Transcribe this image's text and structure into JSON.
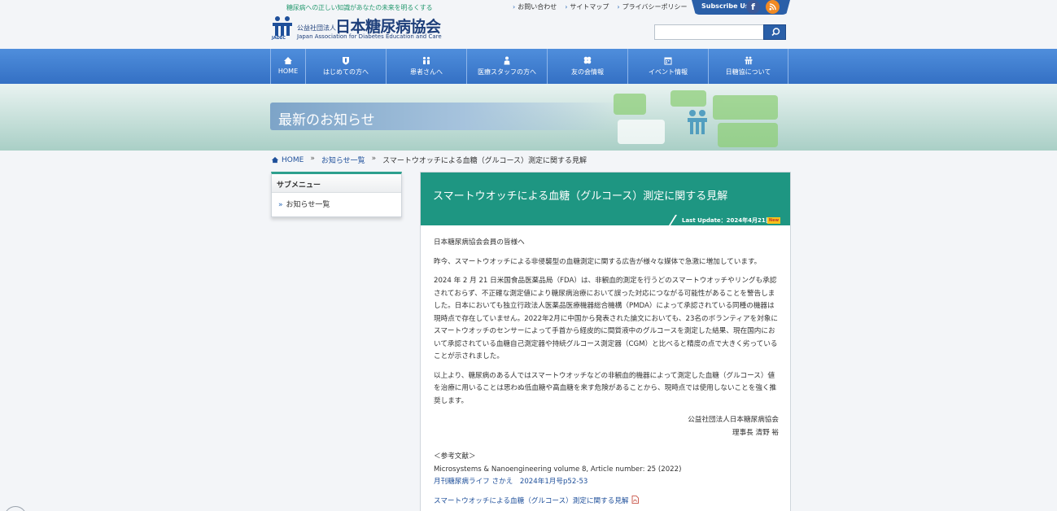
{
  "header": {
    "tagline": "糖尿病への正しい知識があなたの未来を明るくする",
    "logo_caption": "JADEC",
    "org_prefix": "公益社団法人",
    "org_name": "日本糖尿病協会",
    "org_name_en": "Japan Association for Diabetes Education and Care",
    "util_links": [
      "お問い合わせ",
      "サイトマップ",
      "プライバシーポリシー"
    ],
    "subscribe_label": "Subscribe Us",
    "facebook_glyph": "f",
    "search_placeholder": ""
  },
  "nav": {
    "items": [
      {
        "label": "HOME",
        "icon": "home-icon"
      },
      {
        "label": "はじめての方へ",
        "icon": "shield-icon"
      },
      {
        "label": "患者さんへ",
        "icon": "people-icon"
      },
      {
        "label": "医療スタッフの方へ",
        "icon": "doctor-icon"
      },
      {
        "label": "友の会情報",
        "icon": "clover-icon"
      },
      {
        "label": "イベント情報",
        "icon": "calendar-icon"
      },
      {
        "label": "日糖協について",
        "icon": "building-icon"
      }
    ]
  },
  "banner": {
    "title": "最新のお知らせ"
  },
  "breadcrumb": {
    "home": "HOME",
    "list": "お知らせ一覧",
    "current": "スマートウオッチによる血糖（グルコース）測定に関する見解",
    "separator": "»"
  },
  "submenu": {
    "title": "サブメニュー",
    "items": [
      "お知らせ一覧"
    ]
  },
  "article": {
    "title": "スマートウオッチによる血糖（グルコース）測定に関する見解",
    "last_update": "Last Update：2024年4月21日",
    "new_badge": "New",
    "greeting": "日本糖尿病協会会員の皆様へ",
    "p1": "昨今、スマートウオッチによる非侵襲型の血糖測定に関する広告が様々な媒体で急激に増加しています。",
    "p2": "2024 年 2 月 21 日米国食品医薬品局（FDA）は、非観血的測定を行うどのスマートウオッチやリングも承認されておらず、不正確な測定値により糖尿病治療において誤った対応につながる可能性があることを警告しました。日本においても独立行政法人医薬品医療機器総合機構（PMDA）によって承認されている同種の機器は現時点で存在していません。2022年2月に中国から発表された論文においても、23名のボランティアを対象にスマートウオッチのセンサーによって手首から経皮的に間質液中のグルコースを測定した結果、現在国内において承認されている血糖自己測定器や持続グルコース測定器（CGM）と比べると精度の点で大きく劣っていることが示されました。",
    "p3": "以上より、糖尿病のある人ではスマートウオッチなどの非観血的機器によって測定した血糖（グルコース）値を治療に用いることは思わぬ低血糖や高血糖を来す危険があることから、現時点では使用しないことを強く推奨します。",
    "signature_org": "公益社団法人日本糖尿病協会",
    "signature_person": "理事長 清野 裕",
    "refs_heading": "＜参考文献＞",
    "ref1": "Microsystems & Nanoengineering volume 8, Article number: 25 (2022)",
    "ref2": "月刊糖尿病ライフ さかえ　2024年1月号p52-53",
    "pdf_link": "スマートウオッチによる血糖（グルコース）測定に関する見解"
  },
  "colors": {
    "nav_blue": "#3a78cc",
    "header_green": "#1e9682",
    "link_blue": "#1e4f9a",
    "rss_orange": "#f08a24"
  }
}
